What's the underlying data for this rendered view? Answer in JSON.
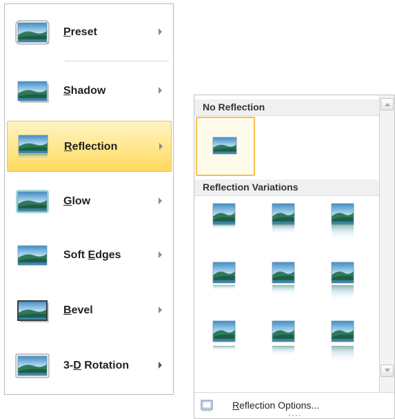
{
  "menu": {
    "items": [
      {
        "label": "Preset",
        "accel": "P",
        "rest": "reset",
        "icon": "preset-picture-icon"
      },
      {
        "label": "Shadow",
        "accel": "S",
        "rest": "hadow",
        "icon": "shadow-picture-icon"
      },
      {
        "label": "Reflection",
        "accel": "R",
        "rest": "eflection",
        "icon": "reflection-picture-icon",
        "highlighted": true
      },
      {
        "label": "Glow",
        "accel": "G",
        "rest": "low",
        "icon": "glow-picture-icon"
      },
      {
        "label": "Soft Edges",
        "before": "Soft ",
        "accel": "E",
        "rest": "dges",
        "icon": "soft-edges-picture-icon"
      },
      {
        "label": "Bevel",
        "accel": "B",
        "rest": "evel",
        "icon": "bevel-picture-icon"
      },
      {
        "label": "3-D Rotation",
        "before": "3-",
        "accel": "D",
        "rest": " Rotation",
        "icon": "3d-rotation-picture-icon"
      }
    ],
    "submenu_arrow_icon": "chevron-right-icon",
    "highlight_color": "#ffe68a"
  },
  "gallery": {
    "no_reflection_header": "No Reflection",
    "variations_header": "Reflection Variations",
    "footer_label": "Reflection Options...",
    "footer_accel": "R",
    "footer_rest": "eflection Options...",
    "footer_icon": "picture-frame-icon",
    "scroll_up_icon": "arrow-up-icon",
    "scroll_down_icon": "arrow-down-icon",
    "grip_icon": "resize-grip-icon",
    "selected_border_color": "#f2c14d"
  }
}
